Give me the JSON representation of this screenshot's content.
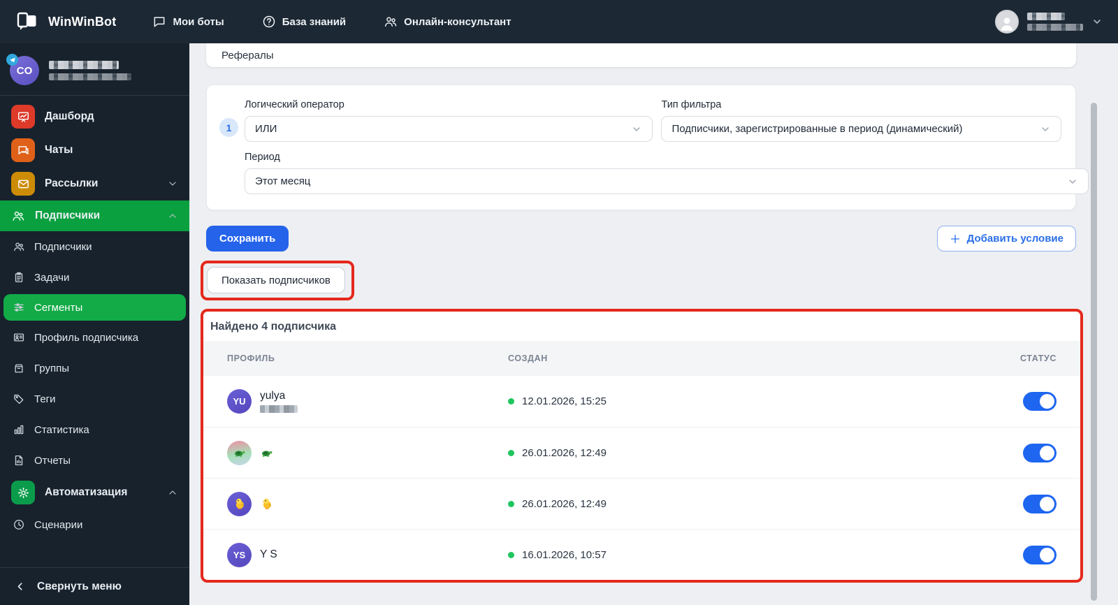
{
  "navbar": {
    "brand": "WinWinBot",
    "items": [
      {
        "label": "Мои боты",
        "icon": "chat-bubble-icon"
      },
      {
        "label": "База знаний",
        "icon": "help-circle-icon"
      },
      {
        "label": "Онлайн-консультант",
        "icon": "people-icon"
      }
    ],
    "user": {
      "name_redacted": true,
      "chevron": "down"
    }
  },
  "sidebar": {
    "user": {
      "initials": "CO",
      "platform_badge": "telegram",
      "name_redacted": true
    },
    "items": [
      {
        "label": "Дашборд",
        "icon": "dashboard-icon",
        "kind": "parent",
        "tile": "#dd3a2a"
      },
      {
        "label": "Чаты",
        "icon": "chats-icon",
        "kind": "parent",
        "tile": "#df6119"
      },
      {
        "label": "Рассылки",
        "icon": "mail-icon",
        "kind": "parent",
        "tile": "#cd8c07",
        "chevron": "down"
      },
      {
        "label": "Подписчики",
        "icon": "users-icon",
        "kind": "section-active",
        "chevron": "up"
      },
      {
        "label": "Подписчики",
        "icon": "users-icon",
        "kind": "sub"
      },
      {
        "label": "Задачи",
        "icon": "tasks-icon",
        "kind": "sub"
      },
      {
        "label": "Сегменты",
        "icon": "segments-icon",
        "kind": "sub",
        "selected": true
      },
      {
        "label": "Профиль подписчика",
        "icon": "profile-card-icon",
        "kind": "sub"
      },
      {
        "label": "Группы",
        "icon": "groups-icon",
        "kind": "sub"
      },
      {
        "label": "Теги",
        "icon": "tag-icon",
        "kind": "sub"
      },
      {
        "label": "Статистика",
        "icon": "stats-icon",
        "kind": "sub"
      },
      {
        "label": "Отчеты",
        "icon": "report-icon",
        "kind": "sub"
      },
      {
        "label": "Автоматизация",
        "icon": "gear-icon",
        "kind": "parent",
        "tile": "#0b9c4b",
        "chevron": "up"
      },
      {
        "label": "Сценарии",
        "icon": "clock-icon",
        "kind": "sub"
      }
    ],
    "collapse_label": "Свернуть меню"
  },
  "content": {
    "top_card_label": "Рефералы",
    "filter": {
      "index": "1",
      "logical_operator_label": "Логический оператор",
      "logical_operator_value": "ИЛИ",
      "filter_type_label": "Тип фильтра",
      "filter_type_value": "Подписчики, зарегистрированные в период (динамический)",
      "period_label": "Период",
      "period_value": "Этот месяц"
    },
    "save_button": "Сохранить",
    "add_condition_button": "Добавить условие",
    "show_subscribers_button": "Показать подписчиков",
    "results": {
      "title": "Найдено 4 подписчика",
      "columns": [
        "ПРОФИЛЬ",
        "СОЗДАН",
        "СТАТУС"
      ],
      "rows": [
        {
          "name": "yulya",
          "username_redacted": true,
          "avatar_type": "initials",
          "avatar_text": "YU",
          "avatar_bg": "linear-gradient(150deg,#6a5fd6,#5547be)",
          "created": "12.01.2026, 15:25",
          "online": true,
          "status_on": true
        },
        {
          "name": "🐢",
          "name_emoji": "turtle",
          "avatar_type": "emoji",
          "avatar_emoji": "turtle",
          "avatar_bg": "linear-gradient(170deg,#ef8fa4,#a6e0b8 55%,#c9d4ea)",
          "created": "26.01.2026, 12:49",
          "online": true,
          "status_on": true
        },
        {
          "name": "🐤",
          "name_emoji": "chick",
          "avatar_type": "emoji",
          "avatar_emoji": "chick",
          "avatar_bg": "linear-gradient(150deg,#6a5fd6,#5547be)",
          "created": "26.01.2026, 12:49",
          "online": true,
          "status_on": true
        },
        {
          "name": "Y S",
          "avatar_type": "initials",
          "avatar_text": "YS",
          "avatar_bg": "linear-gradient(150deg,#6a5fd6,#5547be)",
          "created": "16.01.2026, 10:57",
          "online": true,
          "status_on": true
        }
      ]
    },
    "annotation_color": "#e4291c"
  }
}
